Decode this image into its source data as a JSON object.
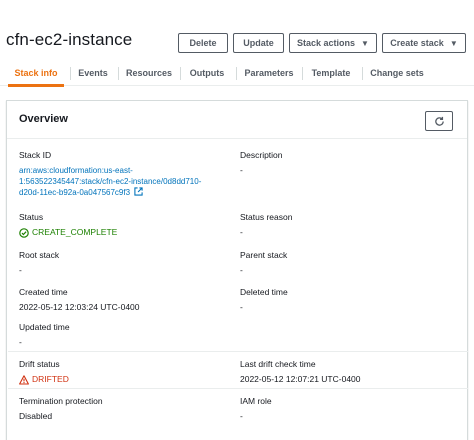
{
  "header": {
    "title": "cfn-ec2-instance",
    "buttons": {
      "delete": "Delete",
      "update": "Update",
      "stack_actions": "Stack actions",
      "create_stack": "Create stack"
    }
  },
  "tabs": [
    {
      "label": "Stack info",
      "active": true
    },
    {
      "label": "Events",
      "active": false
    },
    {
      "label": "Resources",
      "active": false
    },
    {
      "label": "Outputs",
      "active": false
    },
    {
      "label": "Parameters",
      "active": false
    },
    {
      "label": "Template",
      "active": false
    },
    {
      "label": "Change sets",
      "active": false
    }
  ],
  "overview": {
    "title": "Overview",
    "stack_id": {
      "label": "Stack ID",
      "line1": "arn:aws:cloudformation:us-east-",
      "line2": "1:563522345447:stack/cfn-ec2-instance/0d8dd710-",
      "line3": "d20d-11ec-b92a-0a047567c9f3"
    },
    "description": {
      "label": "Description",
      "value": "-"
    },
    "status": {
      "label": "Status",
      "value": "CREATE_COMPLETE"
    },
    "status_reason": {
      "label": "Status reason",
      "value": "-"
    },
    "root_stack": {
      "label": "Root stack",
      "value": "-"
    },
    "parent_stack": {
      "label": "Parent stack",
      "value": "-"
    },
    "created_time": {
      "label": "Created time",
      "value": "2022-05-12 12:03:24 UTC-0400"
    },
    "deleted_time": {
      "label": "Deleted time",
      "value": "-"
    },
    "updated_time": {
      "label": "Updated time",
      "value": "-"
    },
    "drift_status": {
      "label": "Drift status",
      "value": "DRIFTED"
    },
    "last_drift_check": {
      "label": "Last drift check time",
      "value": "2022-05-12 12:07:21 UTC-0400"
    },
    "termination_protection": {
      "label": "Termination protection",
      "value": "Disabled"
    },
    "iam_role": {
      "label": "IAM role",
      "value": "-"
    }
  },
  "colors": {
    "accent": "#ec7211",
    "link": "#0073bb",
    "success": "#1d8102",
    "warning": "#d13212"
  }
}
